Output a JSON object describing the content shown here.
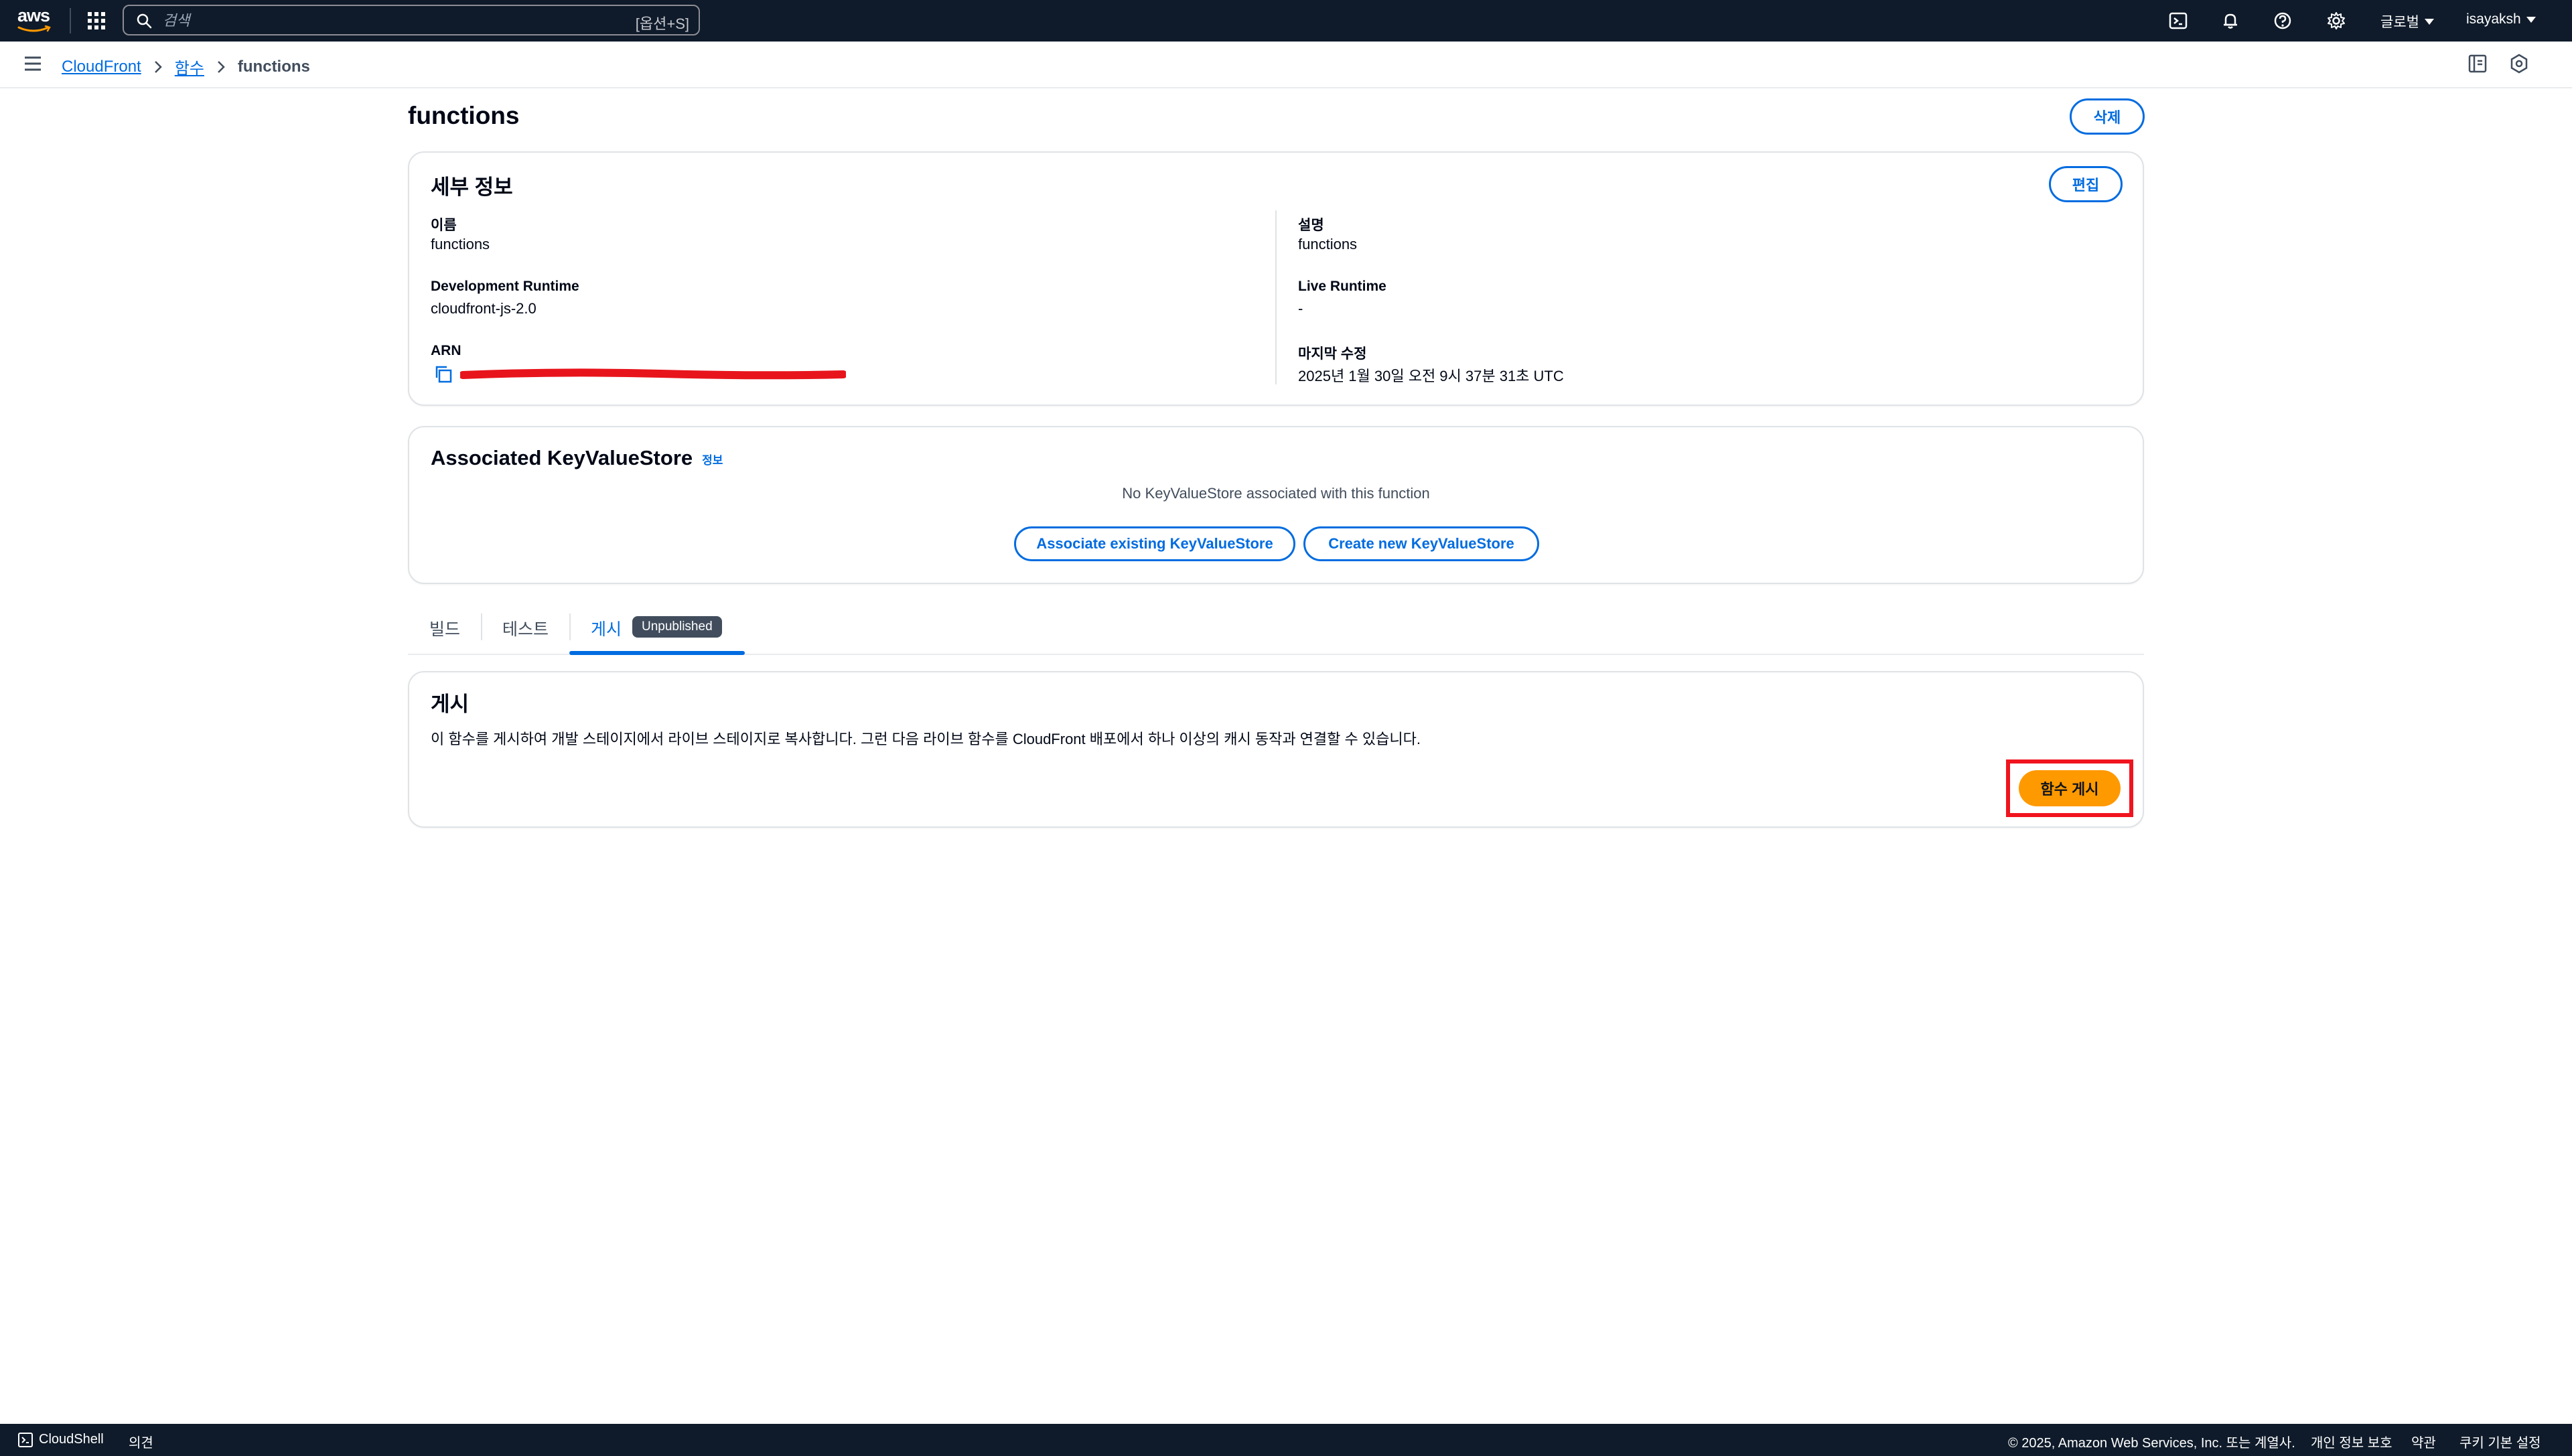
{
  "topnav": {
    "logo_text": "aws",
    "search_placeholder": "검색",
    "search_shortcut": "[옵션+S]",
    "region": "글로벌",
    "user": "isayaksh"
  },
  "breadcrumb": {
    "items": [
      "CloudFront",
      "함수"
    ],
    "current": "functions"
  },
  "page": {
    "title": "functions",
    "delete_label": "삭제"
  },
  "details": {
    "title": "세부 정보",
    "edit_label": "편집",
    "name_label": "이름",
    "name_value": "functions",
    "dev_runtime_label": "Development Runtime",
    "dev_runtime_value": "cloudfront-js-2.0",
    "arn_label": "ARN",
    "desc_label": "설명",
    "desc_value": "functions",
    "live_runtime_label": "Live Runtime",
    "live_runtime_value": "-",
    "last_modified_label": "마지막 수정",
    "last_modified_value": "2025년 1월 30일 오전 9시 37분 31초 UTC"
  },
  "kvs": {
    "title": "Associated KeyValueStore",
    "info_label": "정보",
    "empty_text": "No KeyValueStore associated with this function",
    "associate_label": "Associate existing KeyValueStore",
    "create_label": "Create new KeyValueStore"
  },
  "tabs": {
    "build": "빌드",
    "test": "테스트",
    "publish": "게시",
    "badge": "Unpublished"
  },
  "publish": {
    "title": "게시",
    "description": "이 함수를 게시하여 개발 스테이지에서 라이브 스테이지로 복사합니다. 그런 다음 라이브 함수를 CloudFront 배포에서 하나 이상의 캐시 동작과 연결할 수 있습니다.",
    "button_label": "함수 게시"
  },
  "footer": {
    "cloudshell": "CloudShell",
    "feedback": "의견",
    "copyright": "© 2025, Amazon Web Services, Inc. 또는 계열사.",
    "privacy": "개인 정보 보호",
    "terms": "약관",
    "cookies": "쿠키 기본 설정"
  },
  "colors": {
    "nav_bg": "#0f1b2a",
    "link": "#006ce0",
    "primary": "#ff9900",
    "highlight": "#f0141e"
  },
  "icons": [
    "aws-logo",
    "apps-grid-icon",
    "search-icon",
    "cloudshell-icon",
    "bell-icon",
    "help-icon",
    "gear-icon",
    "menu-icon",
    "chevron-right-icon",
    "info-panel-icon",
    "settings-hex-icon",
    "copy-icon"
  ]
}
